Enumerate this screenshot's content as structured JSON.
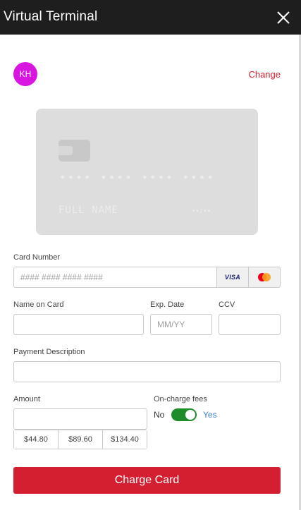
{
  "header": {
    "title": "Virtual Terminal",
    "close_icon": "close-icon"
  },
  "customer": {
    "initials": "KH",
    "avatar_color": "#d915e0",
    "change_label": "Change"
  },
  "card_preview": {
    "number_mask": "•••• •••• •••• ••••",
    "name_placeholder": "FULL NAME",
    "expiry_mask": "••/••"
  },
  "form": {
    "card_number": {
      "label": "Card Number",
      "placeholder": "#### #### #### ####",
      "value": ""
    },
    "brands": {
      "visa": "VISA",
      "mastercard_icon": "mastercard-icon"
    },
    "name_on_card": {
      "label": "Name on Card",
      "value": ""
    },
    "exp_date": {
      "label": "Exp. Date",
      "placeholder": "MM/YY",
      "value": ""
    },
    "ccv": {
      "label": "CCV",
      "value": ""
    },
    "payment_description": {
      "label": "Payment Description",
      "value": ""
    },
    "amount": {
      "label": "Amount",
      "value": "",
      "presets": [
        "$44.80",
        "$89.60",
        "$134.40"
      ]
    },
    "oncharge_fees": {
      "label": "On-charge fees",
      "off_label": "No",
      "on_label": "Yes",
      "enabled": true
    }
  },
  "actions": {
    "charge_label": "Charge Card"
  },
  "colors": {
    "accent": "#d41f31",
    "toggle_on": "#1e8c2a",
    "link_blue": "#3a7bd5",
    "header_bg": "#1e1e1e"
  }
}
